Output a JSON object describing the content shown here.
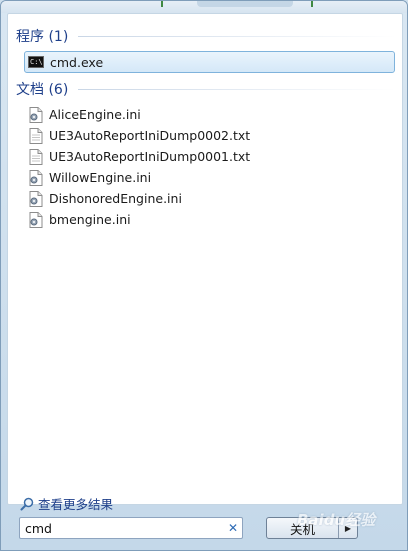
{
  "groups": {
    "programs": {
      "title": "程序 (1)",
      "items": [
        {
          "label": "cmd.exe",
          "icon": "cmd-icon"
        }
      ]
    },
    "documents": {
      "title": "文档 (6)",
      "items": [
        {
          "label": "AliceEngine.ini",
          "icon": "config-file-icon"
        },
        {
          "label": "UE3AutoReportIniDump0002.txt",
          "icon": "text-file-icon"
        },
        {
          "label": "UE3AutoReportIniDump0001.txt",
          "icon": "text-file-icon"
        },
        {
          "label": "WillowEngine.ini",
          "icon": "config-file-icon"
        },
        {
          "label": "DishonoredEngine.ini",
          "icon": "config-file-icon"
        },
        {
          "label": "bmengine.ini",
          "icon": "config-file-icon"
        }
      ]
    }
  },
  "more_results": {
    "label": "查看更多结果",
    "icon": "magnifier-icon"
  },
  "search": {
    "value": "cmd",
    "clear_glyph": "✕"
  },
  "shutdown": {
    "label": "关机",
    "arrow_glyph": "▶"
  },
  "watermark": {
    "text": "Baidu经验"
  },
  "colors": {
    "header_text": "#1e3f8a",
    "selection_border": "#7fb3dc",
    "frame": "#c4d8e9"
  }
}
